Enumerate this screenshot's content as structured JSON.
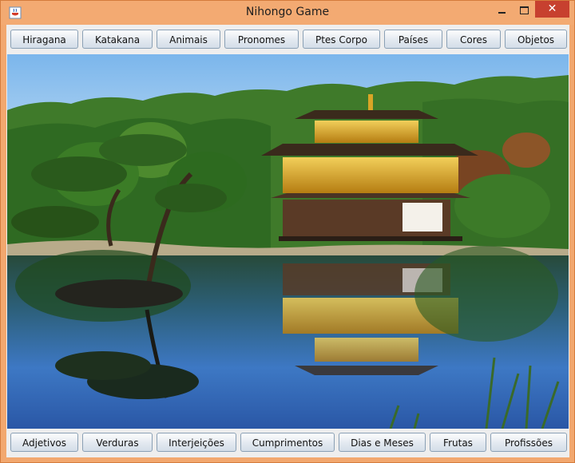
{
  "window": {
    "title": "Nihongo Game",
    "close_glyph": "✕"
  },
  "top_buttons": [
    "Hiragana",
    "Katakana",
    "Animais",
    "Pronomes",
    "Ptes Corpo",
    "Países",
    "Cores",
    "Objetos"
  ],
  "bottom_buttons": [
    "Adjetivos",
    "Verduras",
    "Interjeições",
    "Cumprimentos",
    "Dias e Meses",
    "Frutas",
    "Profissões"
  ],
  "image": {
    "subject": "golden-pavilion-temple-reflected-in-pond"
  },
  "colors": {
    "title_bar": "#f3aa72",
    "close_button": "#c7402f",
    "sky": "#8fc3ee",
    "water": "#2f5f9c",
    "gold": "#d9a526"
  },
  "icons": {
    "app": "java-coffee-cup-icon"
  }
}
